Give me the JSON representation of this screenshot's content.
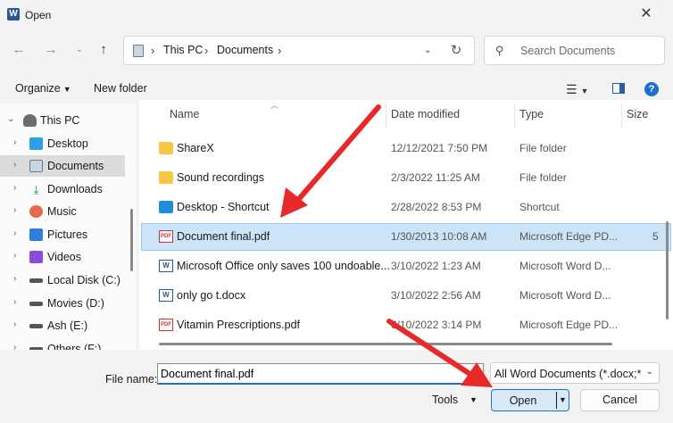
{
  "window": {
    "title": "Open",
    "app_icon_letter": "W"
  },
  "address": {
    "crumbs": [
      "This PC",
      "Documents"
    ]
  },
  "search": {
    "placeholder": "Search Documents"
  },
  "toolbar": {
    "organize_label": "Organize",
    "new_folder_label": "New folder"
  },
  "nav": {
    "items": [
      {
        "label": "This PC",
        "icon": "pc-icon"
      },
      {
        "label": "Desktop",
        "icon": "desktop-icon"
      },
      {
        "label": "Documents",
        "icon": "documents-icon",
        "selected": true
      },
      {
        "label": "Downloads",
        "icon": "downloads-icon"
      },
      {
        "label": "Music",
        "icon": "music-icon"
      },
      {
        "label": "Pictures",
        "icon": "pictures-icon"
      },
      {
        "label": "Videos",
        "icon": "videos-icon"
      },
      {
        "label": "Local Disk (C:)",
        "icon": "drive-icon"
      },
      {
        "label": "Movies (D:)",
        "icon": "drive-icon"
      },
      {
        "label": "Ash (E:)",
        "icon": "drive-icon"
      },
      {
        "label": "Others (F:)",
        "icon": "drive-icon"
      }
    ]
  },
  "columns": {
    "name": "Name",
    "date": "Date modified",
    "type": "Type",
    "size": "Size"
  },
  "files": [
    {
      "name": "ShareX",
      "date": "12/12/2021 7:50 PM",
      "type": "File folder",
      "size": "",
      "icon": "folder-icon"
    },
    {
      "name": "Sound recordings",
      "date": "2/3/2022 11:25 AM",
      "type": "File folder",
      "size": "",
      "icon": "folder-icon"
    },
    {
      "name": "Desktop - Shortcut",
      "date": "2/28/2022 8:53 PM",
      "type": "Shortcut",
      "size": "",
      "icon": "shortcut-icon"
    },
    {
      "name": "Document final.pdf",
      "date": "1/30/2013 10:08 AM",
      "type": "Microsoft Edge PD...",
      "size": "5",
      "icon": "pdf-icon",
      "selected": true
    },
    {
      "name": "Microsoft Office only saves 100 undoable...",
      "date": "3/10/2022 1:23 AM",
      "type": "Microsoft Word D...",
      "size": "",
      "icon": "word-icon"
    },
    {
      "name": "only go t.docx",
      "date": "3/10/2022 2:56 AM",
      "type": "Microsoft Word D...",
      "size": "",
      "icon": "word-icon"
    },
    {
      "name": "Vitamin Prescriptions.pdf",
      "date": "3/10/2022 3:14 PM",
      "type": "Microsoft Edge PD...",
      "size": "",
      "icon": "pdf-icon"
    }
  ],
  "footer": {
    "file_name_label": "File name:",
    "file_name_value": "Document final.pdf",
    "file_type": "All Word Documents (*.docx;*.d",
    "tools_label": "Tools",
    "open_label": "Open",
    "cancel_label": "Cancel"
  },
  "colors": {
    "accent": "#1f6fd1",
    "annotation_arrow": "#e8292a",
    "selection": "#cce4f7"
  }
}
